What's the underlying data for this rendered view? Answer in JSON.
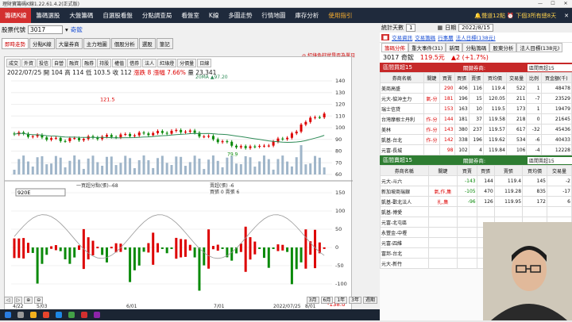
{
  "title": "理財寶籌碼K線1.22.61.4.2(正式版)",
  "menu": [
    "籌碼K線",
    "籌碼選股",
    "大盤籌碼",
    "自選股看盤",
    "分點調查局",
    "看盤室",
    "K線",
    "多圖走勢",
    "行情地圖",
    "庫存分析",
    "使用指引"
  ],
  "sound": "🔔聲道12點 ⏰ 下個3所有總8天",
  "stock": {
    "label": "股票代號",
    "code": "3017",
    "name": "奇鋐"
  },
  "leftTabs": [
    "即時走勢",
    "分點K線",
    "大量券商",
    "主力地圖",
    "個股分析",
    "選股",
    "筆記"
  ],
  "note": "◎ 紅綠色柱狀是否為單日",
  "subTabs": [
    "成交",
    "外資",
    "投信",
    "自營",
    "融資",
    "融券",
    "持股",
    "權值",
    "借券",
    "法人",
    "紅綠燈",
    "分價量",
    "日線"
  ],
  "ohlc": {
    "date": "2022/07/25",
    "open": "開 104",
    "high": "高 114",
    "low": "低 103.5",
    "close": "收 112",
    "chg": "漲跌 8",
    "pct": "漲幅 7.66%",
    "vol": "量 23,341"
  },
  "ma": "20MA ▲97.20",
  "marks": {
    "hi": "121.5",
    "lo": "79.9"
  },
  "ind": {
    "sel": "920E",
    "title": "一買超分點(張)--68",
    "sub": "賣超(張) -6",
    "sub2": "買張 0 賣張 6",
    "min": "-138.0"
  },
  "xaxis": [
    "4/22",
    "5/03",
    "6/01",
    "7/01",
    "2022/07/25",
    "8/01"
  ],
  "year": "2022",
  "bottom": [
    "3月",
    "6月",
    "1年",
    "3年",
    "週期"
  ],
  "right": {
    "days": "統計天數",
    "days_v": "1",
    "date": "2022/8/15",
    "day_label": "日期",
    "links": [
      "交易資訊",
      "交易籌碼",
      "行事曆",
      "法人日標(138元)"
    ],
    "tabs": [
      "籌碼分佈",
      "重大事件(31)",
      "新聞",
      "分點籌碼",
      "股東分析",
      "法人目標(138元)"
    ],
    "quote_code": "3017 奇鋐",
    "quote_px": "119.5元",
    "quote_chg": "▲2 (+1.7%)",
    "buy_hdr": "區間買超15",
    "buy_sel": "區間買超15",
    "sell_hdr": "區間賣超15",
    "sell_sel": "區間賣超15",
    "broker_label": "關鍵券商:",
    "cols": [
      "券商名稱",
      "關鍵",
      "買賣",
      "買張",
      "賣張",
      "買均價",
      "交易量",
      "比例",
      "買金額(千)"
    ],
    "buy": [
      [
        "美商高盛",
        "",
        "290",
        "406",
        "116",
        "119.4",
        "522",
        "1",
        "48478"
      ],
      [
        "元大-惦沖主力",
        "氣-分",
        "181",
        "196",
        "15",
        "120.05",
        "211",
        "-7",
        "23529"
      ],
      [
        "瑞士信貸",
        "",
        "153",
        "163",
        "10",
        "119.5",
        "173",
        "1",
        "19479"
      ],
      [
        "台灣摩根士丹利",
        "作-分",
        "144",
        "181",
        "37",
        "119.58",
        "218",
        "0",
        "21645"
      ],
      [
        "美林",
        "作-分",
        "143",
        "380",
        "237",
        "119.57",
        "617",
        "-32",
        "45436"
      ],
      [
        "凱基-台北",
        "作-分",
        "142",
        "338",
        "196",
        "119.62",
        "534",
        "-6",
        "40433"
      ],
      [
        "元富-長城",
        "",
        "98",
        "102",
        "4",
        "119.84",
        "106",
        "-4",
        "12228"
      ]
    ],
    "sell": [
      [
        "元大-斗六",
        "",
        "-143",
        "144",
        "119.4",
        "145",
        "-2"
      ],
      [
        "新加坡商瑞銀",
        "氣,作,集",
        "-105",
        "470",
        "119.28",
        "835",
        "-17"
      ],
      [
        "凱基-歡北法人",
        "扎,集",
        "-96",
        "126",
        "119.95",
        "172",
        "6"
      ],
      [
        "凱基-博愛",
        "",
        "",
        "",
        "",
        "",
        ""
      ],
      [
        "元富-北屯區",
        "",
        "",
        "",
        "",
        "",
        ""
      ],
      [
        "永豐金-中壢",
        "",
        "",
        "",
        "",
        "",
        ""
      ],
      [
        "元富-四維",
        "",
        "",
        "",
        "",
        "",
        ""
      ],
      [
        "富邦-台北",
        "",
        "",
        "",
        "",
        "",
        ""
      ],
      [
        "元大-新竹",
        "",
        "",
        "",
        "",
        "",
        ""
      ]
    ]
  },
  "chart_data": {
    "type": "candlestick",
    "title": "",
    "ylim": [
      60,
      140
    ],
    "yticks": [
      60,
      70,
      80,
      90,
      100,
      110,
      120,
      130,
      140
    ],
    "ind_yticks": [
      150,
      100,
      50,
      0,
      -50,
      -100
    ],
    "hi": 121.5,
    "lo": 79.9
  }
}
